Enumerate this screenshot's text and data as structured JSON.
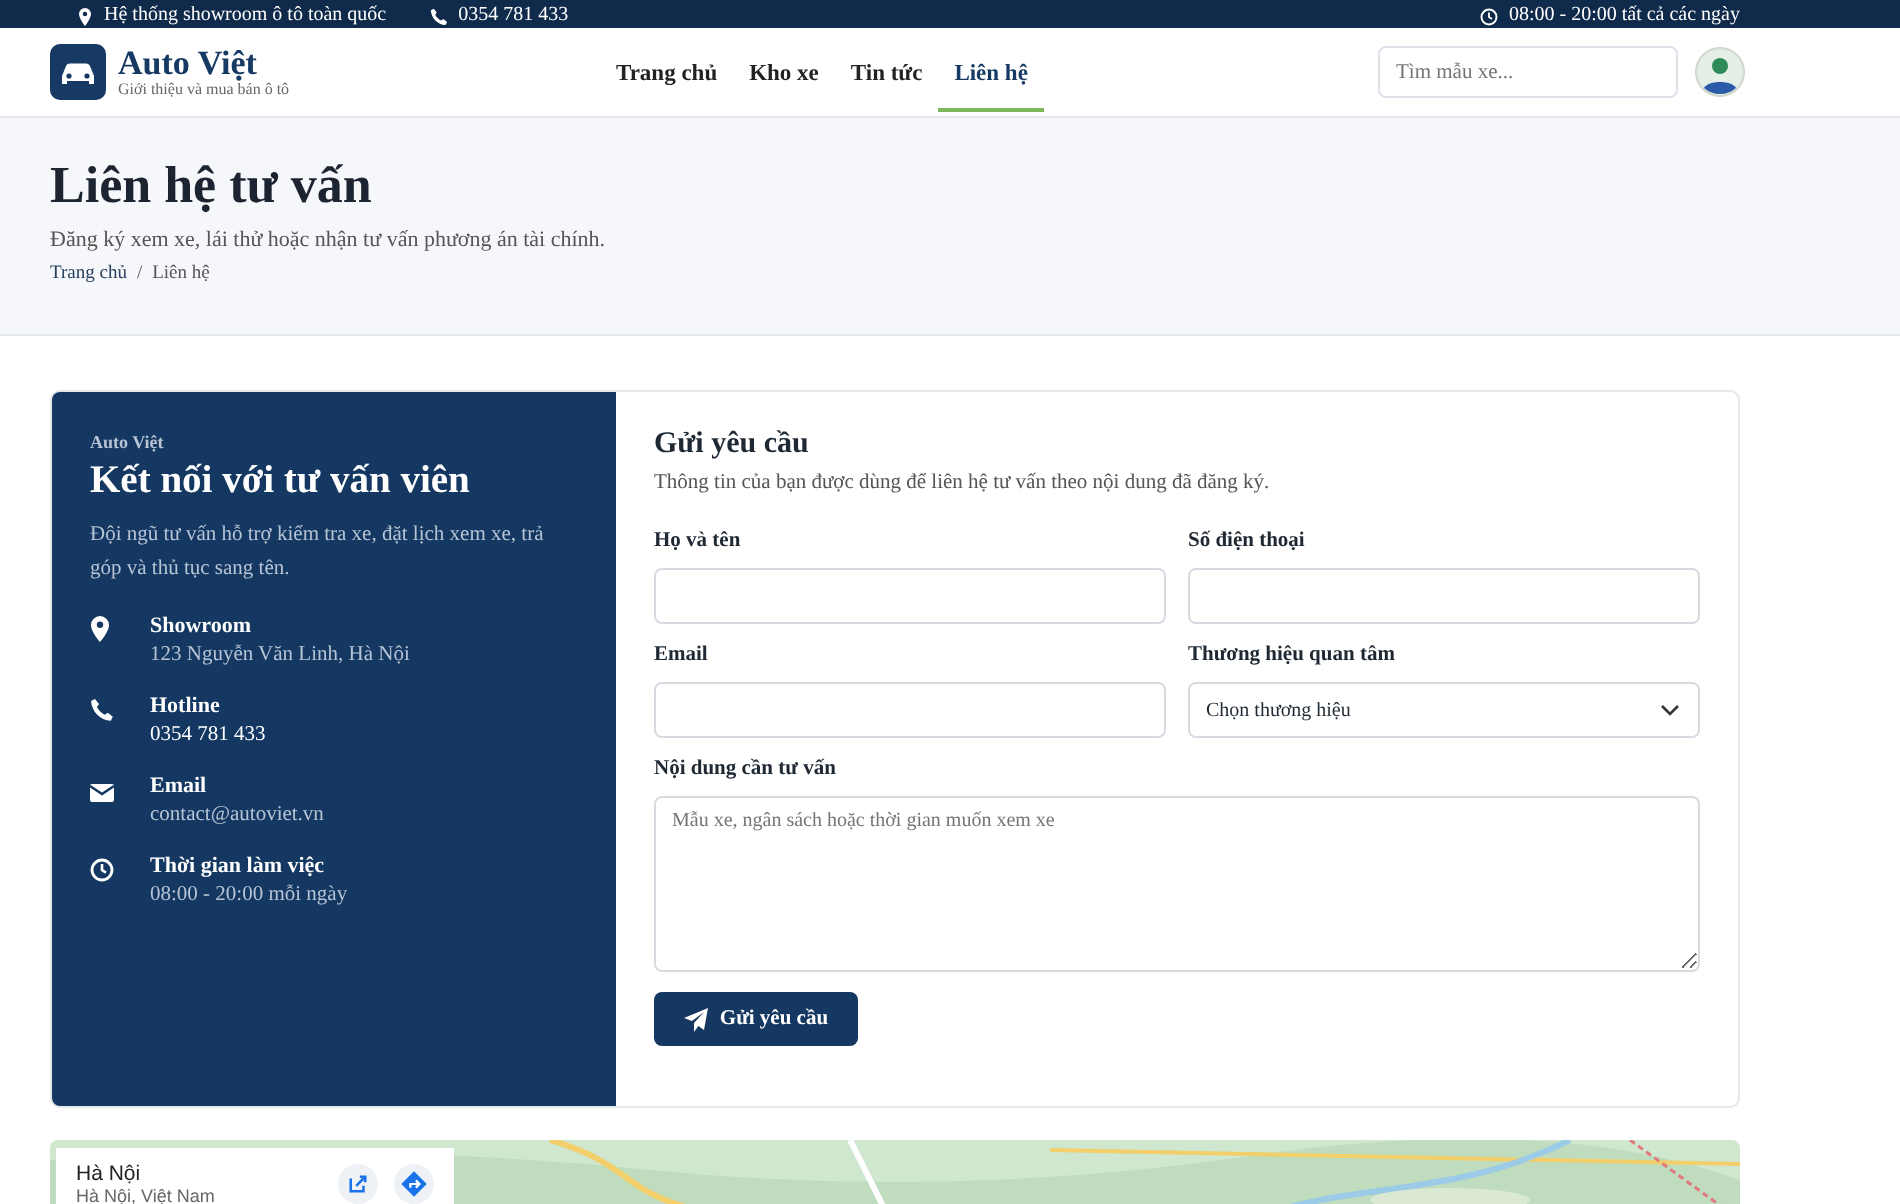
{
  "topbar": {
    "items": [
      {
        "kind": "pin",
        "text": "Hệ thống showroom ô tô toàn quốc"
      },
      {
        "kind": "phone",
        "text": "0354 781 433"
      }
    ],
    "hours": "08:00 - 20:00 tất cả các ngày"
  },
  "header": {
    "brand": "Auto Việt",
    "tagline": "Giới thiệu và mua bán ô tô",
    "nav": [
      {
        "label": "Trang chủ",
        "selected": false
      },
      {
        "label": "Kho xe",
        "selected": false
      },
      {
        "label": "Tin tức",
        "selected": false
      },
      {
        "label": "Liên hệ",
        "selected": true
      }
    ],
    "search": {
      "placeholder": "Tìm mẫu xe..."
    }
  },
  "hero": {
    "title": "Liên hệ tư vấn",
    "subtitle": "Đăng ký xem xe, lái thử hoặc nhận tư vấn phương án tài chính.",
    "breadcrumb": [
      "Trang chủ",
      "Liên hệ"
    ],
    "breadcrumb_separator": "/"
  },
  "contact": {
    "eyebrow": "Auto Việt",
    "title": "Kết nối với tư vấn viên",
    "text": "Đội ngũ tư vấn hỗ trợ kiểm tra xe, đặt lịch xem xe, trả góp và thủ tục sang tên.",
    "items": [
      {
        "kind": "pin",
        "label": "Showroom",
        "value": "123 Nguyễn Văn Linh, Hà Nội"
      },
      {
        "kind": "phone",
        "label": "Hotline",
        "value": "0354 781 433"
      },
      {
        "kind": "mail",
        "label": "Email",
        "value": "contact@autoviet.vn"
      },
      {
        "kind": "clock",
        "label": "Thời gian làm việc",
        "value": "08:00 - 20:00 mỗi ngày"
      }
    ]
  },
  "form": {
    "title": "Gửi yêu cầu",
    "subtitle": "Thông tin của bạn được dùng để liên hệ tư vấn theo nội dung đã đăng ký.",
    "fields": [
      {
        "kind": "text",
        "label": "Họ và tên"
      },
      {
        "kind": "text",
        "label": "Số điện thoại"
      },
      {
        "kind": "text",
        "label": "Email"
      },
      {
        "kind": "select",
        "label": "Thương hiệu quan tâm",
        "value": "Chọn thương hiệu"
      },
      {
        "kind": "textarea",
        "label": "Nội dung cần tư vấn",
        "placeholder": "Mẫu xe, ngân sách hoặc thời gian muốn xem xe"
      }
    ],
    "submit": "Gửi yêu cầu"
  },
  "map": {
    "kind": "picture",
    "place": "Hà Nội",
    "address": "Hà Nội, Việt Nam"
  }
}
